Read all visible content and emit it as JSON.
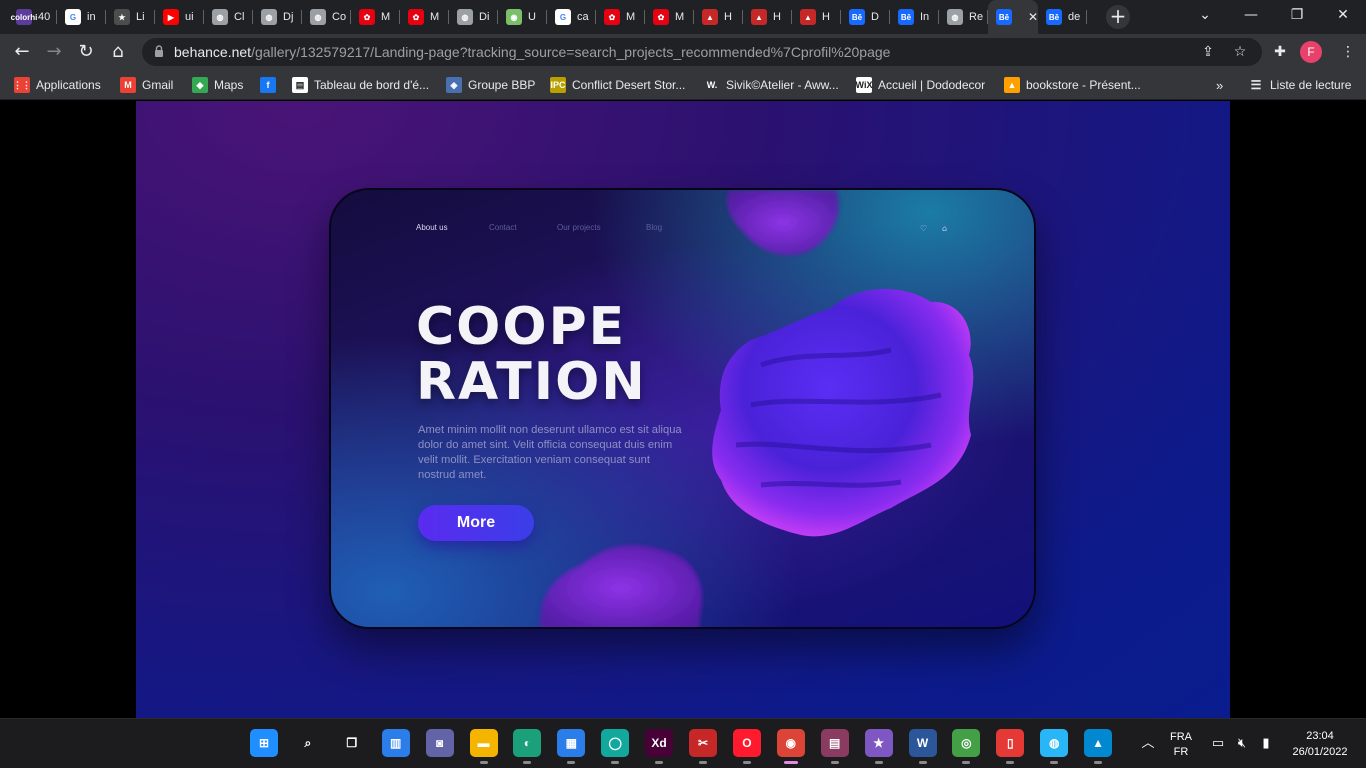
{
  "browser": {
    "tabs": [
      {
        "title": "40",
        "favicon": "coloris-icon",
        "color": "#5b3c9b",
        "glyph": "colorhi"
      },
      {
        "title": "in",
        "favicon": "google-icon",
        "color": "#ffffff",
        "glyph": "G"
      },
      {
        "title": "Li",
        "favicon": "star-icon",
        "color": "#4d4d4d",
        "glyph": "★"
      },
      {
        "title": "ui",
        "favicon": "youtube-icon",
        "color": "#ff0000",
        "glyph": "▶"
      },
      {
        "title": "Cl",
        "favicon": "globe-icon",
        "color": "#9aa0a6",
        "glyph": "◍"
      },
      {
        "title": "Dj",
        "favicon": "globe-icon",
        "color": "#9aa0a6",
        "glyph": "◍"
      },
      {
        "title": "Co",
        "favicon": "globe-icon",
        "color": "#9aa0a6",
        "glyph": "◍"
      },
      {
        "title": "M",
        "favicon": "huawei-icon",
        "color": "#e60012",
        "glyph": "✿"
      },
      {
        "title": "M",
        "favicon": "huawei-icon",
        "color": "#e60012",
        "glyph": "✿"
      },
      {
        "title": "Di",
        "favicon": "globe-icon",
        "color": "#9aa0a6",
        "glyph": "◍"
      },
      {
        "title": "U",
        "favicon": "owl-icon",
        "color": "#7bbf6a",
        "glyph": "◉"
      },
      {
        "title": "ca",
        "favicon": "google-icon",
        "color": "#ffffff",
        "glyph": "G"
      },
      {
        "title": "M",
        "favicon": "huawei-icon",
        "color": "#e60012",
        "glyph": "✿"
      },
      {
        "title": "M",
        "favicon": "huawei-icon",
        "color": "#e60012",
        "glyph": "✿"
      },
      {
        "title": "H",
        "favicon": "hat-icon",
        "color": "#c62828",
        "glyph": "▲"
      },
      {
        "title": "H",
        "favicon": "hat-icon",
        "color": "#c62828",
        "glyph": "▲"
      },
      {
        "title": "H",
        "favicon": "hat-icon",
        "color": "#c62828",
        "glyph": "▲"
      },
      {
        "title": "D",
        "favicon": "behance-icon",
        "color": "#1769ff",
        "glyph": "Bē"
      },
      {
        "title": "In",
        "favicon": "behance-icon",
        "color": "#1769ff",
        "glyph": "Bē"
      },
      {
        "title": "Re",
        "favicon": "globe-icon",
        "color": "#9aa0a6",
        "glyph": "◍"
      },
      {
        "title": "",
        "favicon": "behance-icon",
        "color": "#1769ff",
        "glyph": "Bē",
        "active": true
      },
      {
        "title": "de",
        "favicon": "behance-icon",
        "color": "#1769ff",
        "glyph": "Bē"
      }
    ],
    "url_host": "behance.net",
    "url_path": "/gallery/132579217/Landing-page?tracking_source=search_projects_recommended%7Cprofil%20page",
    "profile_initial": "F",
    "bookmarks": [
      {
        "label": "Applications",
        "icon": "apps-grid-icon",
        "color": "#ea4335",
        "glyph": "⋮⋮"
      },
      {
        "label": "Gmail",
        "icon": "gmail-icon",
        "color": "#ea4335",
        "glyph": "M"
      },
      {
        "label": "Maps",
        "icon": "maps-icon",
        "color": "#34a853",
        "glyph": "◆"
      },
      {
        "label": "",
        "icon": "facebook-icon",
        "color": "#1877f2",
        "glyph": "f"
      },
      {
        "label": "Tableau de bord d'é...",
        "icon": "trello-icon",
        "color": "#ffffff",
        "glyph": "▤"
      },
      {
        "label": "Groupe BBP",
        "icon": "bbp-icon",
        "color": "#4a6fb0",
        "glyph": "◈"
      },
      {
        "label": "Conflict Desert Stor...",
        "icon": "ipc-icon",
        "color": "#b8a000",
        "glyph": "IPC"
      },
      {
        "label": "Sivik©Atelier - Aww...",
        "icon": "w-icon",
        "color": "#35363a",
        "glyph": "W."
      },
      {
        "label": "Accueil | Dododecor",
        "icon": "wix-icon",
        "color": "#ffffff",
        "glyph": "WiX"
      },
      {
        "label": "bookstore - Présent...",
        "icon": "firebase-icon",
        "color": "#ffa000",
        "glyph": "▲"
      }
    ],
    "reading_list": "Liste de lecture"
  },
  "landing": {
    "nav": [
      "About us",
      "Contact",
      "Our projects",
      "Blog"
    ],
    "headline_line1": "COOPE",
    "headline_line2": "RATION",
    "body": "Amet minim mollit non deserunt ullamco est sit aliqua dolor do amet sint. Velit officia consequat duis enim velit mollit. Exercitation veniam consequat sunt nostrud amet.",
    "button": "More",
    "colors": {
      "accent": "#5a2bf0",
      "blob": "#7a2cf0"
    }
  },
  "taskbar": {
    "apps": [
      {
        "name": "start-button-icon",
        "glyph": "⊞",
        "color": "#1f8fff"
      },
      {
        "name": "search-icon",
        "glyph": "⌕",
        "color": "#1c1c1f"
      },
      {
        "name": "task-view-icon",
        "glyph": "❐",
        "color": "#1c1c1f"
      },
      {
        "name": "widgets-icon",
        "glyph": "▥",
        "color": "#2b7de9"
      },
      {
        "name": "teams-chat-icon",
        "glyph": "◙",
        "color": "#6264a7"
      },
      {
        "name": "file-explorer-icon",
        "glyph": "▬",
        "color": "#f4b400"
      },
      {
        "name": "edge-icon",
        "glyph": "◐",
        "color": "#1aa07a"
      },
      {
        "name": "store-icon",
        "glyph": "▦",
        "color": "#2b7de9"
      },
      {
        "name": "app-circle-icon",
        "glyph": "◯",
        "color": "#13a89e"
      },
      {
        "name": "adobe-xd-icon",
        "glyph": "Xd",
        "color": "#470137"
      },
      {
        "name": "snipping-tool-icon",
        "glyph": "✂",
        "color": "#c62828"
      },
      {
        "name": "opera-icon",
        "glyph": "O",
        "color": "#ff1b2d"
      },
      {
        "name": "chrome-icon",
        "glyph": "◉",
        "color": "#db4437",
        "active": true
      },
      {
        "name": "winrar-icon",
        "glyph": "▤",
        "color": "#8b3a62"
      },
      {
        "name": "star-app-icon",
        "glyph": "★",
        "color": "#7e57c2"
      },
      {
        "name": "word-icon",
        "glyph": "W",
        "color": "#2b579a"
      },
      {
        "name": "network-app-icon",
        "glyph": "◎",
        "color": "#43a047"
      },
      {
        "name": "phone-link-icon",
        "glyph": "▯",
        "color": "#e53935"
      },
      {
        "name": "globe-app-icon",
        "glyph": "◍",
        "color": "#29b6f6"
      },
      {
        "name": "photos-icon",
        "glyph": "▲",
        "color": "#0288d1"
      }
    ],
    "lang_top": "FRA",
    "lang_bottom": "FR",
    "time": "23:04",
    "date": "26/01/2022"
  }
}
